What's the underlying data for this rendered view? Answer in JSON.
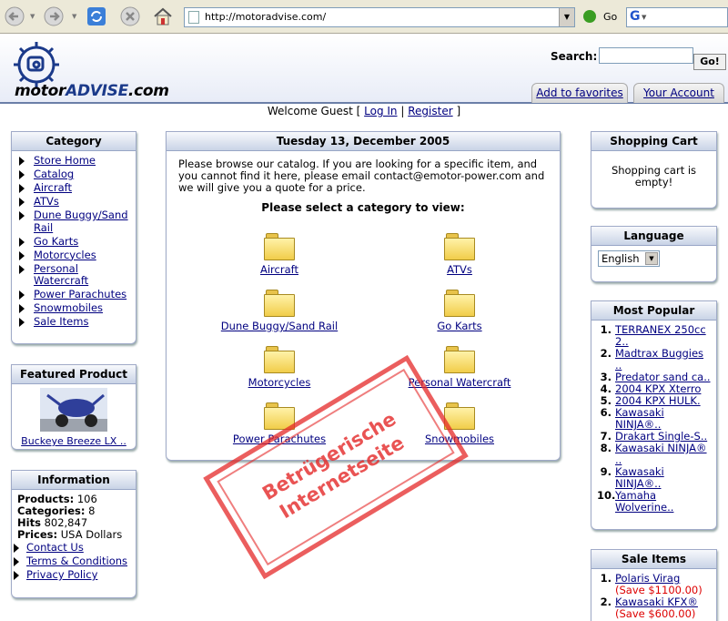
{
  "browser": {
    "url": "http://motoradvise.com/",
    "go_label": "Go",
    "search_icon": "google-g-icon"
  },
  "header": {
    "logo_text_a": "motor",
    "logo_text_b": "ADVISE",
    "logo_text_c": ".com",
    "search_label": "Search:",
    "search_button": "Go!",
    "tab_favorites": "Add to favorites",
    "tab_account": "Your Account"
  },
  "welcome": {
    "prefix": "Welcome Guest [",
    "login": "Log In",
    "sep": "|",
    "register": "Register",
    "suffix": "]"
  },
  "category_box": {
    "title": "Category",
    "items": [
      {
        "label": "Store Home"
      },
      {
        "label": "Catalog"
      },
      {
        "label": "Aircraft"
      },
      {
        "label": "ATVs"
      },
      {
        "label": "Dune Buggy/Sand Rail"
      },
      {
        "label": "Go Karts"
      },
      {
        "label": "Motorcycles"
      },
      {
        "label": "Personal Watercraft"
      },
      {
        "label": "Power Parachutes"
      },
      {
        "label": "Snowmobiles"
      },
      {
        "label": "Sale Items"
      }
    ]
  },
  "featured": {
    "title": "Featured Product",
    "product": "Buckeye Breeze LX .."
  },
  "information": {
    "title": "Information",
    "products_label": "Products:",
    "products_value": "106",
    "categories_label": "Categories:",
    "categories_value": "8",
    "hits_label": "Hits",
    "hits_value": "802,847",
    "prices_label": "Prices:",
    "prices_value": "USA Dollars",
    "links": [
      "Contact Us",
      "Terms & Conditions",
      "Privacy Policy"
    ]
  },
  "main": {
    "date": "Tuesday 13, December 2005",
    "intro": "Please browse our catalog. If you are looking for a specific item, and you cannot find it here, please email contact@emotor-power.com and we will give you a quote for a price.",
    "select_heading": "Please select a category to view:",
    "categories": [
      "Aircraft",
      "ATVs",
      "Dune Buggy/Sand Rail",
      "Go Karts",
      "Motorcycles",
      "Personal Watercraft",
      "Power Parachutes",
      "Snowmobiles"
    ]
  },
  "stamp": {
    "line1": "Betrügerische",
    "line2": "Internetseite"
  },
  "cart": {
    "title": "Shopping Cart",
    "text": "Shopping cart is empty!"
  },
  "language": {
    "title": "Language",
    "selected": "English"
  },
  "popular": {
    "title": "Most Popular",
    "items": [
      {
        "num": "1.",
        "label": "TERRANEX 250cc 2.."
      },
      {
        "num": "2.",
        "label": "Madtrax Buggies .."
      },
      {
        "num": "3.",
        "label": "Predator sand ca.."
      },
      {
        "num": "4.",
        "label": "2004 KPX Xterro"
      },
      {
        "num": "5.",
        "label": "2004 KPX HULK."
      },
      {
        "num": "6.",
        "label": "Kawasaki NINJA®.."
      },
      {
        "num": "7.",
        "label": "Drakart Single-S.."
      },
      {
        "num": "8.",
        "label": "Kawasaki NINJA® .."
      },
      {
        "num": "9.",
        "label": "Kawasaki NINJA®.."
      },
      {
        "num": "10.",
        "label": "Yamaha Wolverine.."
      }
    ]
  },
  "sale": {
    "title": "Sale Items",
    "items": [
      {
        "num": "1.",
        "label": "Polaris Virag",
        "save": "(Save $1100.00)"
      },
      {
        "num": "2.",
        "label": "Kawasaki KFX®",
        "save": "(Save $600.00)"
      }
    ]
  },
  "colors": {
    "link": "#000080",
    "stamp": "#e42828",
    "header_border": "#6b7fa8"
  }
}
